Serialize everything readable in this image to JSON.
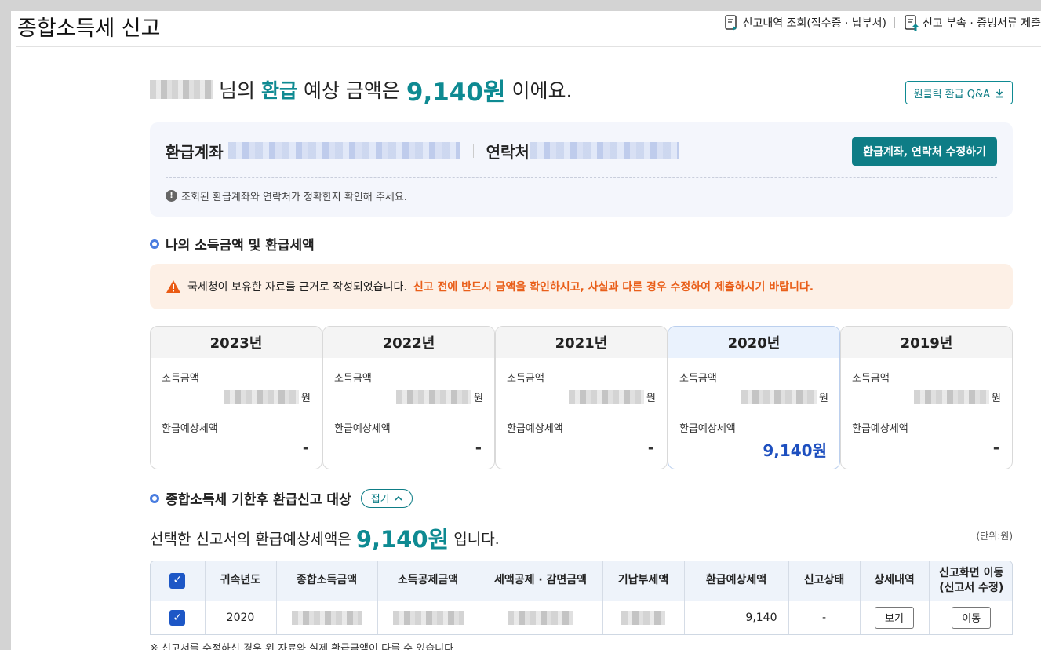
{
  "header": {
    "title": "종합소득세 신고",
    "links": [
      {
        "label": "신고내역 조회(접수증 · 납부서)",
        "icon": "document-check-icon"
      },
      {
        "label": "신고 부속 · 증빙서류 제출",
        "icon": "document-upload-icon"
      }
    ]
  },
  "greeting": {
    "name_suffix": "님의",
    "refund_word": "환급",
    "middle": "예상 금액은",
    "amount": "9,140원",
    "end": "이에요."
  },
  "qa_button": "원클릭 환급 Q&A",
  "account": {
    "account_label": "환급계좌",
    "contact_label": "연락처",
    "edit_button": "환급계좌, 연락처 수정하기",
    "note": "조회된 환급계좌와 연락처가 정확한지 확인해 주세요."
  },
  "section1": {
    "title": "나의 소득금액 및 환급세액"
  },
  "warning": {
    "normal": "국세청이 보유한 자료를 근거로 작성되었습니다.",
    "emphasis": "신고 전에 반드시 금액을 확인하시고, 사실과 다른 경우 수정하여 제출하시기 바랍니다."
  },
  "year_cards": [
    {
      "year": "2023년",
      "income_label": "소득금액",
      "income_unit": "원",
      "tax_label": "환급예상세액",
      "tax": "-"
    },
    {
      "year": "2022년",
      "income_label": "소득금액",
      "income_unit": "원",
      "tax_label": "환급예상세액",
      "tax": "-"
    },
    {
      "year": "2021년",
      "income_label": "소득금액",
      "income_unit": "원",
      "tax_label": "환급예상세액",
      "tax": "-"
    },
    {
      "year": "2020년",
      "income_label": "소득금액",
      "income_unit": "원",
      "tax_label": "환급예상세액",
      "tax": "9,140원"
    },
    {
      "year": "2019년",
      "income_label": "소득금액",
      "income_unit": "원",
      "tax_label": "환급예상세액",
      "tax": "-"
    }
  ],
  "section2": {
    "title": "종합소득세 기한후 환급신고 대상",
    "fold_button": "접기"
  },
  "selection": {
    "prefix": "선택한 신고서의 환급예상세액은",
    "amount": "9,140원",
    "suffix": "입니다.",
    "unit": "(단위:원)"
  },
  "table": {
    "headers": [
      "귀속년도",
      "종합소득금액",
      "소득공제금액",
      "세액공제 · 감면금액",
      "기납부세액",
      "환급예상세액",
      "신고상태",
      "상세내역",
      "신고화면 이동",
      "(신고서 수정)"
    ],
    "row": {
      "year": "2020",
      "refund": "9,140",
      "status": "-",
      "detail_button": "보기",
      "move_button": "이동"
    }
  },
  "footnote": "※ 신고서를 수정하신 경우 위 자료와 실제 환급금액이 다를 수 있습니다."
}
